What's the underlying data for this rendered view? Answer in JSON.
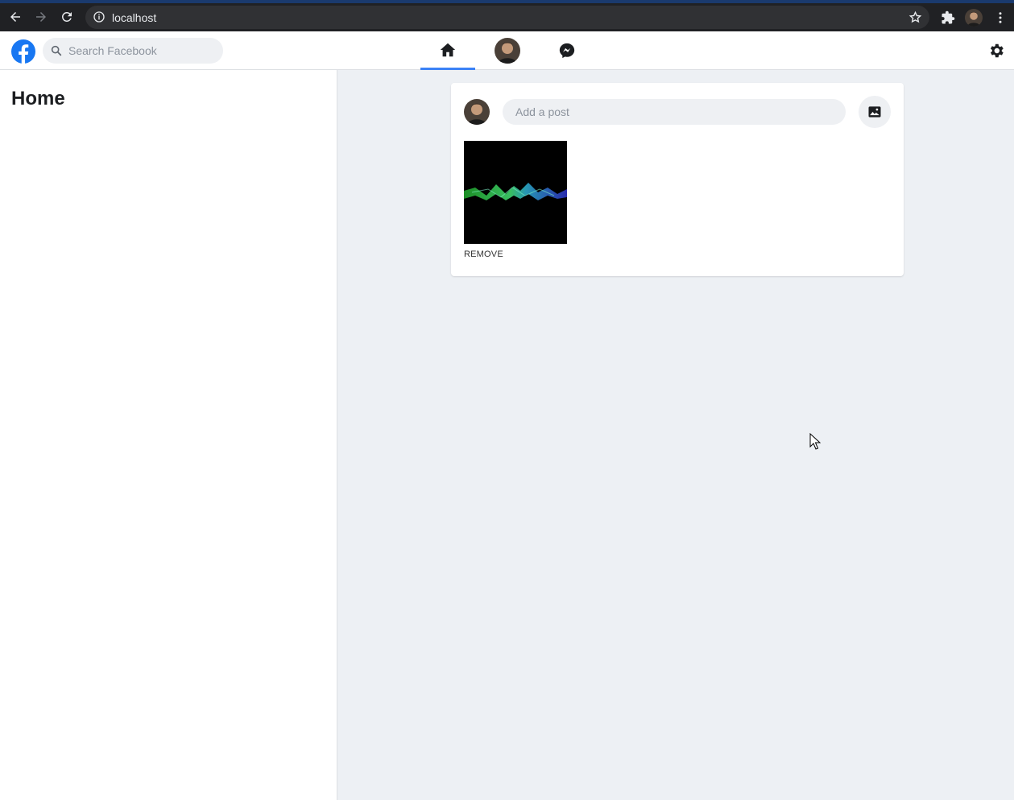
{
  "browser": {
    "url": "localhost",
    "icons": [
      "back-icon",
      "forward-icon",
      "reload-icon",
      "info-icon",
      "star-icon",
      "extensions-icon",
      "profile-avatar",
      "menu-icon"
    ]
  },
  "header": {
    "search_placeholder": "Search Facebook",
    "tabs": [
      {
        "name": "home",
        "icon": "home-icon",
        "active": true
      },
      {
        "name": "profile",
        "icon": "avatar",
        "active": false
      },
      {
        "name": "messenger",
        "icon": "messenger-icon",
        "active": false
      }
    ],
    "accent_color": "#3b82f6",
    "brand_color": "#1877f2"
  },
  "sidebar": {
    "title": "Home"
  },
  "composer": {
    "placeholder": "Add a post",
    "remove_label": "REMOVE"
  }
}
